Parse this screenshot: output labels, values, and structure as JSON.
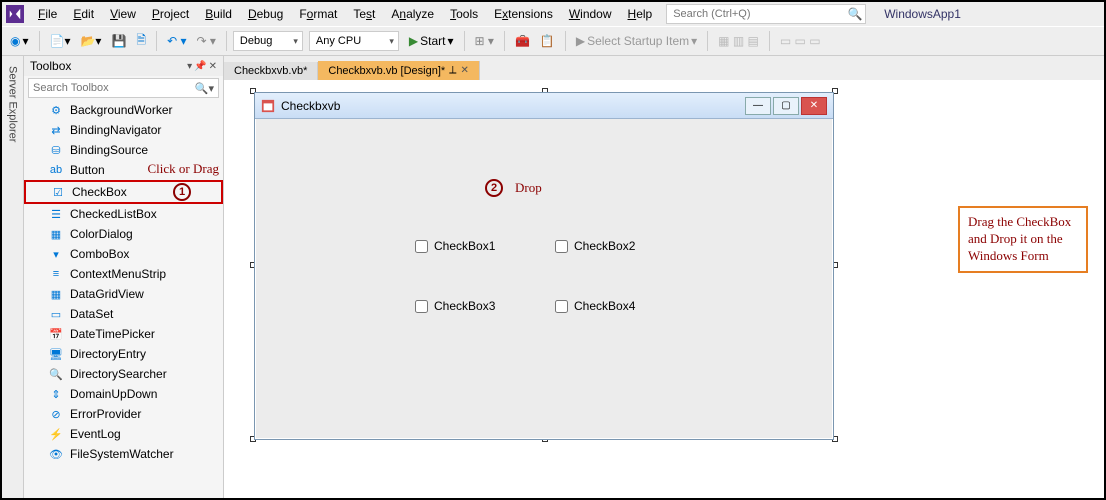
{
  "app": {
    "name": "WindowsApp1",
    "search_placeholder": "Search (Ctrl+Q)"
  },
  "menu": {
    "file": "File",
    "edit": "Edit",
    "view": "View",
    "project": "Project",
    "build": "Build",
    "debug": "Debug",
    "format": "Format",
    "test": "Test",
    "analyze": "Analyze",
    "tools": "Tools",
    "extensions": "Extensions",
    "window": "Window",
    "help": "Help"
  },
  "toolbar": {
    "config_label": "Debug",
    "platform_label": "Any CPU",
    "start_label": "Start",
    "startup_label": "Select Startup Item"
  },
  "server_explorer": {
    "label": "Server Explorer"
  },
  "toolbox": {
    "title": "Toolbox",
    "search_placeholder": "Search Toolbox",
    "items": [
      {
        "icon": "⚙",
        "label": "BackgroundWorker"
      },
      {
        "icon": "⇄",
        "label": "BindingNavigator"
      },
      {
        "icon": "⛁",
        "label": "BindingSource"
      },
      {
        "icon": "ab",
        "label": "Button"
      },
      {
        "icon": "☑",
        "label": "CheckBox"
      },
      {
        "icon": "☰",
        "label": "CheckedListBox"
      },
      {
        "icon": "▦",
        "label": "ColorDialog"
      },
      {
        "icon": "▾",
        "label": "ComboBox"
      },
      {
        "icon": "≡",
        "label": "ContextMenuStrip"
      },
      {
        "icon": "▦",
        "label": "DataGridView"
      },
      {
        "icon": "▭",
        "label": "DataSet"
      },
      {
        "icon": "📅",
        "label": "DateTimePicker"
      },
      {
        "icon": "🖥",
        "label": "DirectoryEntry"
      },
      {
        "icon": "🔍",
        "label": "DirectorySearcher"
      },
      {
        "icon": "⇕",
        "label": "DomainUpDown"
      },
      {
        "icon": "⊘",
        "label": "ErrorProvider"
      },
      {
        "icon": "⚡",
        "label": "EventLog"
      },
      {
        "icon": "👁",
        "label": "FileSystemWatcher"
      }
    ]
  },
  "tabs": {
    "code": "Checkbxvb.vb*",
    "design": "Checkbxvb.vb [Design]*"
  },
  "form": {
    "title": "Checkbxvb",
    "checkboxes": [
      "CheckBox1",
      "CheckBox2",
      "CheckBox3",
      "CheckBox4"
    ]
  },
  "annotations": {
    "click_or_drag": "Click or Drag",
    "drop": "Drop",
    "one": "1",
    "two": "2",
    "note": "Drag the CheckBox and Drop it on the Windows Form"
  }
}
